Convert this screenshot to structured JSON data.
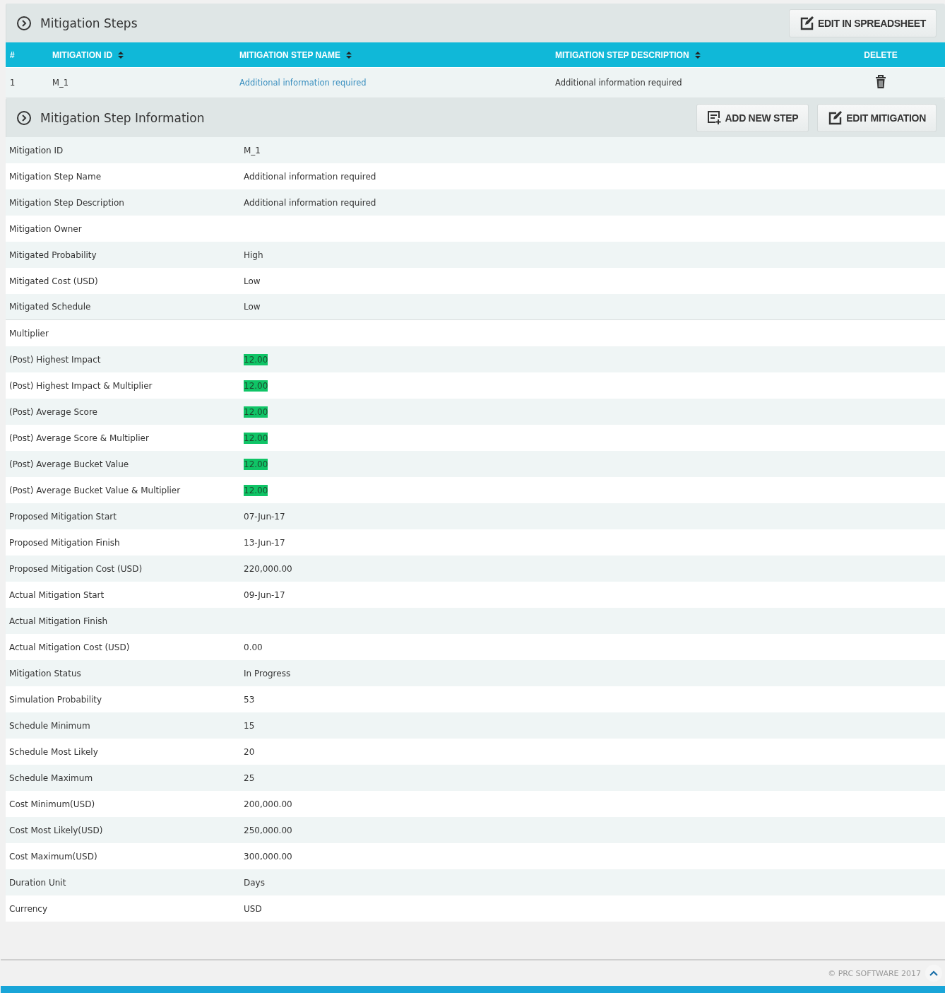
{
  "steps_panel": {
    "title": "Mitigation Steps",
    "button": "EDIT IN SPREADSHEET"
  },
  "steps_table": {
    "columns": [
      {
        "label": "#"
      },
      {
        "label": "MITIGATION ID",
        "sortable": true
      },
      {
        "label": "MITIGATION STEP NAME",
        "sortable": true
      },
      {
        "label": "MITIGATION STEP DESCRIPTION",
        "sortable": true
      },
      {
        "label": "DELETE"
      }
    ],
    "rows": [
      {
        "number": "1",
        "id": "M_1",
        "name": "Additional information required",
        "description": "Additional information required"
      }
    ]
  },
  "info_panel": {
    "title": "Mitigation Step Information",
    "buttons": [
      {
        "label": "ADD NEW STEP",
        "kind": "add"
      },
      {
        "label": "EDIT MITIGATION",
        "kind": "edit"
      }
    ]
  },
  "fields": [
    {
      "label": "Mitigation ID",
      "value": "M_1"
    },
    {
      "label": "Mitigation Step Name",
      "value": "Additional information required"
    },
    {
      "label": "Mitigation Step Description",
      "value": "Additional information required"
    },
    {
      "label": "Mitigation Owner"
    },
    {
      "label": "Mitigated Probability",
      "value": "High"
    },
    {
      "label": "Mitigated Cost (USD)",
      "value": "Low"
    },
    {
      "label": "Mitigated Schedule",
      "value": "Low"
    },
    {
      "label": "Multiplier"
    },
    {
      "label": "(Post) Highest Impact",
      "value": "12.00",
      "highlight": true
    },
    {
      "label": "(Post) Highest Impact & Multiplier",
      "value": "12.00",
      "highlight": true
    },
    {
      "label": "(Post) Average Score",
      "value": "12.00",
      "highlight": true
    },
    {
      "label": "(Post) Average Score & Multiplier",
      "value": "12.00",
      "highlight": true
    },
    {
      "label": "(Post) Average Bucket Value",
      "value": "12.00",
      "highlight": true
    },
    {
      "label": "(Post) Average Bucket Value & Multiplier",
      "value": "12.00",
      "highlight": true
    },
    {
      "label": "Proposed Mitigation Start",
      "value": "07-Jun-17"
    },
    {
      "label": "Proposed Mitigation Finish",
      "value": "13-Jun-17"
    },
    {
      "label": "Proposed Mitigation Cost (USD)",
      "value": "220,000.00"
    },
    {
      "label": "Actual Mitigation Start",
      "value": "09-Jun-17"
    },
    {
      "label": "Actual Mitigation Finish"
    },
    {
      "label": "Actual Mitigation Cost (USD)",
      "value": "0.00"
    },
    {
      "label": "Mitigation Status",
      "value": "In Progress"
    },
    {
      "label": "Simulation Probability",
      "value": "53"
    },
    {
      "label": "Schedule Minimum",
      "value": "15"
    },
    {
      "label": "Schedule Most Likely",
      "value": "20"
    },
    {
      "label": "Schedule Maximum",
      "value": "25"
    },
    {
      "label": "Cost Minimum(USD)",
      "value": "200,000.00"
    },
    {
      "label": "Cost Most Likely(USD)",
      "value": "250,000.00"
    },
    {
      "label": "Cost Maximum(USD)",
      "value": "300,000.00"
    },
    {
      "label": "Duration Unit",
      "value": "Days"
    },
    {
      "label": "Currency",
      "value": "USD"
    }
  ],
  "footer": {
    "copyright": "© PRC SOFTWARE 2017"
  }
}
